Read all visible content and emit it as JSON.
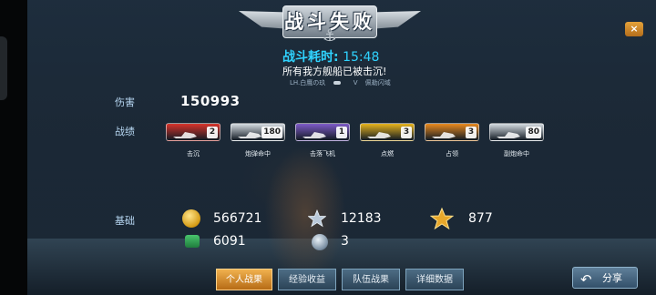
{
  "header": {
    "title": "战斗失败",
    "close_label": "×"
  },
  "battle": {
    "duration_label": "战斗耗时:",
    "duration_value": "15:48",
    "result_message": "所有我方舰船已被击沉!",
    "player_left": "LH.白鹰の玖",
    "vs_text": "V",
    "player_right": "佩勒闪域"
  },
  "stats": {
    "damage_label": "伤害",
    "damage_value": "150993",
    "record_label": "战绩",
    "badges": [
      {
        "label": "击沉",
        "count": "2",
        "color": "#d8342b",
        "icon": "ship-icon"
      },
      {
        "label": "炮弹命中",
        "count": "180",
        "color": "#d7dde2",
        "icon": "shell-icon"
      },
      {
        "label": "击落飞机",
        "count": "1",
        "color": "#7e5bc8",
        "icon": "plane-icon"
      },
      {
        "label": "点燃",
        "count": "3",
        "color": "#e7b31d",
        "icon": "fire-icon"
      },
      {
        "label": "占领",
        "count": "3",
        "color": "#ea8a1f",
        "icon": "capture-icon"
      },
      {
        "label": "副炮命中",
        "count": "80",
        "color": "#d7dde2",
        "icon": "secondary-gun-icon"
      }
    ]
  },
  "base": {
    "label": "基础",
    "gold_value": "566721",
    "star_value": "12183",
    "rank_value": "877",
    "exp_value": "6091",
    "orb_value": "3"
  },
  "tabs": [
    "个人战果",
    "经验收益",
    "队伍战果",
    "详细数据"
  ],
  "share_label": "分享"
}
